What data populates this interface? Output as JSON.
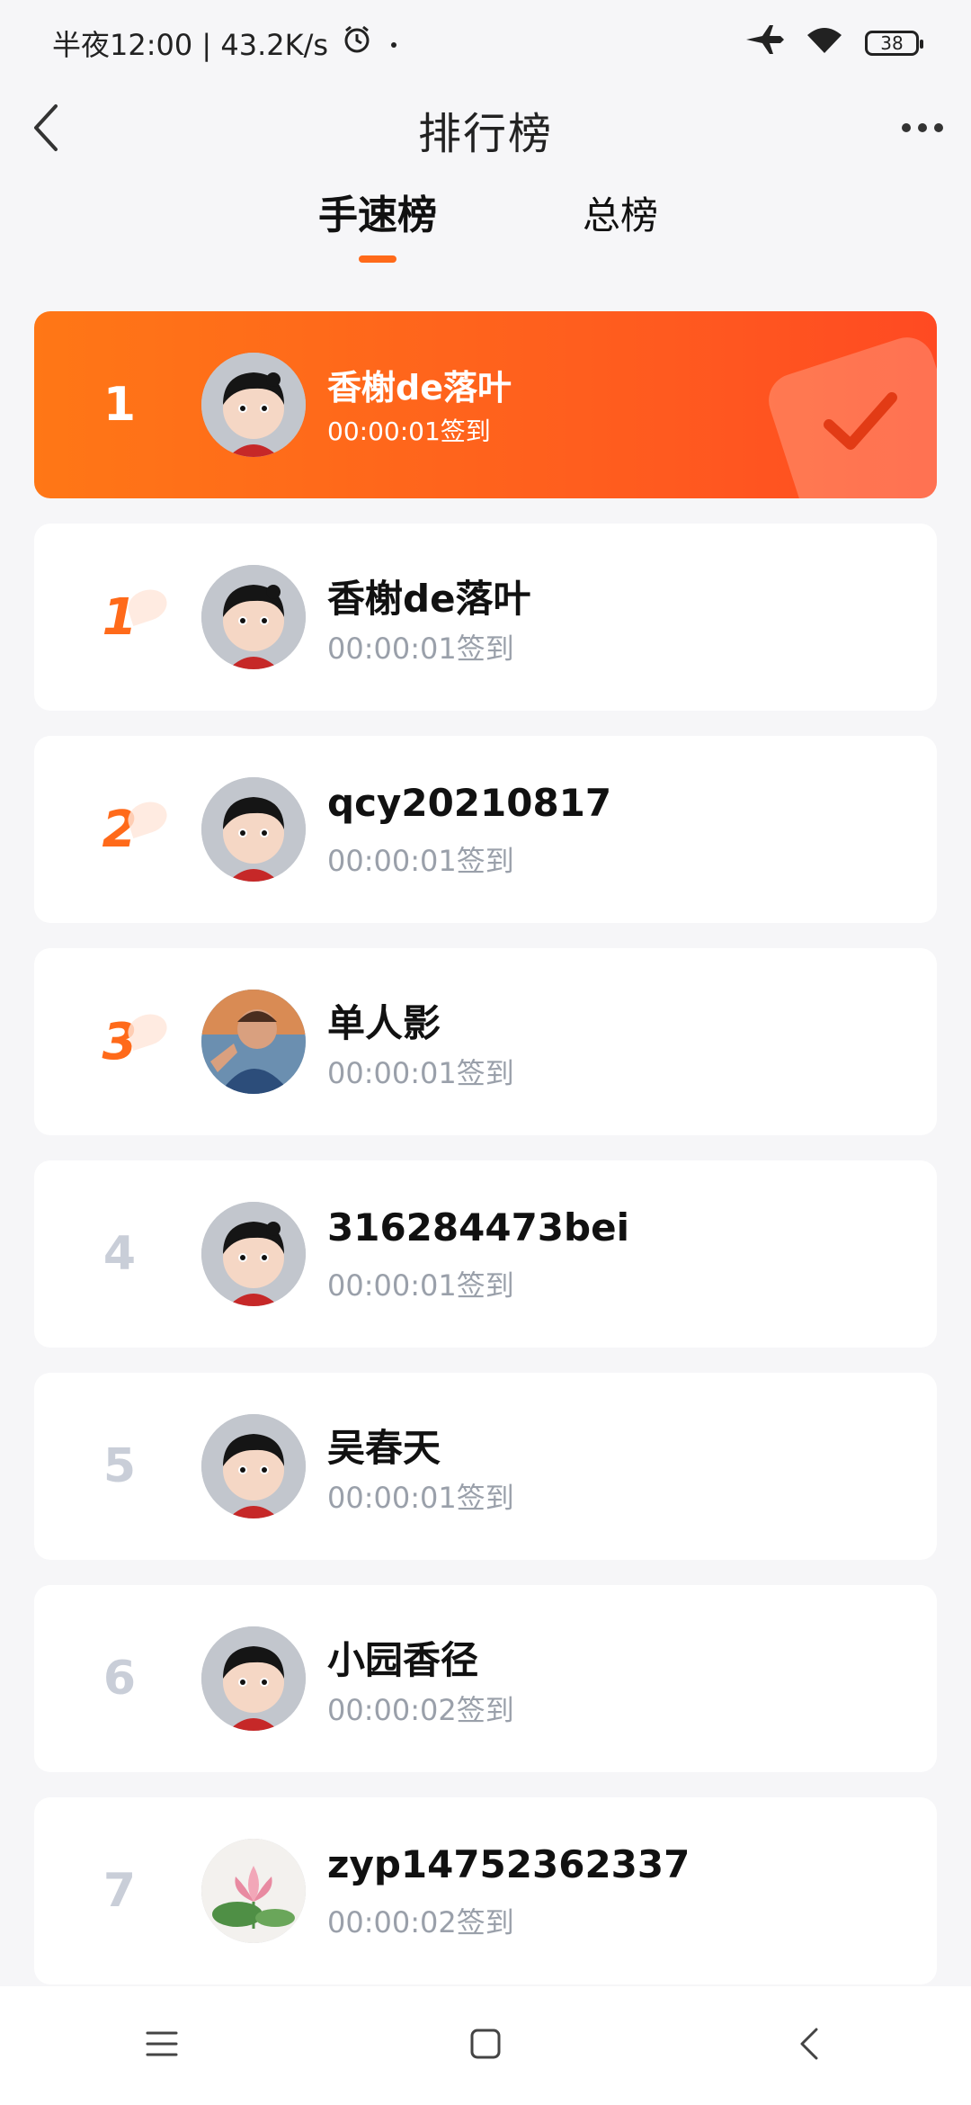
{
  "status": {
    "time_text": "半夜12:00 | 43.2K/s",
    "battery": "38",
    "icons": [
      "alarm-icon",
      "dot-icon",
      "airplane-icon",
      "wifi-icon",
      "battery-icon"
    ]
  },
  "header": {
    "title": "排行榜",
    "icons": [
      "back-chevron-icon",
      "more-dots-icon"
    ]
  },
  "tabs": [
    {
      "label": "手速榜",
      "active": true
    },
    {
      "label": "总榜",
      "active": false
    }
  ],
  "my_entry": {
    "rank": "1",
    "name": "香榭de落叶",
    "time": "00:00:01签到",
    "avatar": "cartoon-avatar",
    "stamp": "checkmark-stamp"
  },
  "leaderboard": [
    {
      "rank": "1",
      "name": "香榭de落叶",
      "time": "00:00:01签到",
      "avatar": "cartoon-avatar"
    },
    {
      "rank": "2",
      "name": "qcy20210817",
      "time": "00:00:01签到",
      "avatar": "cartoon-avatar"
    },
    {
      "rank": "3",
      "name": "单人影",
      "time": "00:00:01签到",
      "avatar": "photo-avatar"
    },
    {
      "rank": "4",
      "name": "316284473bei",
      "time": "00:00:01签到",
      "avatar": "cartoon-avatar"
    },
    {
      "rank": "5",
      "name": "吴春天",
      "time": "00:00:01签到",
      "avatar": "cartoon-avatar"
    },
    {
      "rank": "6",
      "name": "小园香径",
      "time": "00:00:02签到",
      "avatar": "cartoon-avatar"
    },
    {
      "rank": "7",
      "name": "zyp14752362337",
      "time": "00:00:02签到",
      "avatar": "lotus-avatar"
    }
  ],
  "colors": {
    "accent": "#ff6a1a",
    "highlight_start": "#ff7716",
    "highlight_end": "#ff4a22",
    "muted_rank": "#c9ced8",
    "time_text": "#9aa0aa",
    "background": "#f6f6f8"
  },
  "nav": [
    "menu-icon",
    "home-icon",
    "back-icon"
  ]
}
